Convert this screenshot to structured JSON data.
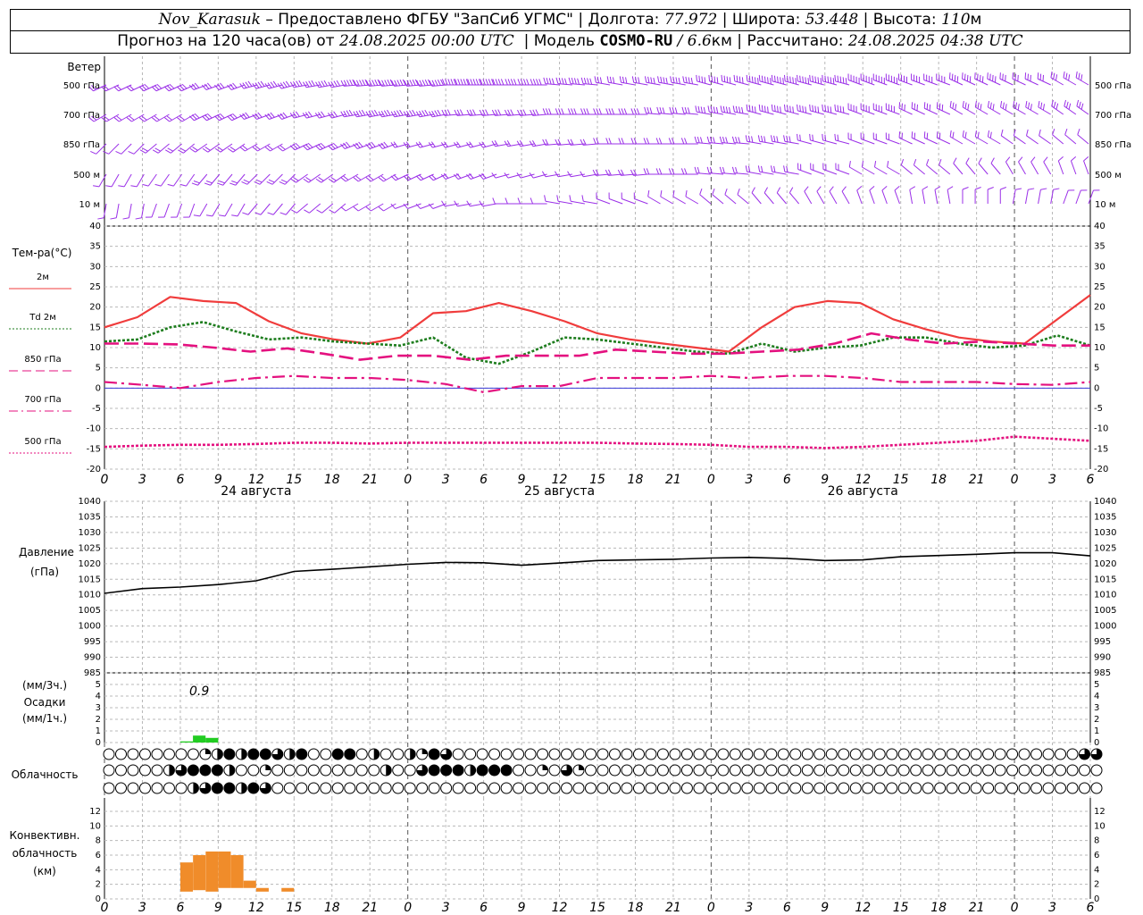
{
  "header": {
    "station": "Nov_Karasuk",
    "provider": "– Предоставлено ФГБУ \"ЗапСиб УГМС\"",
    "lon_label": "Долгота:",
    "lon_value": "77.972",
    "lat_label": "Широта:",
    "lat_value": "53.448",
    "alt_label": "Высота:",
    "alt_value": "110",
    "alt_unit": "м",
    "forecast_prefix": "Прогноз на 120 часа(ов) от",
    "forecast_start": "24.08.2025 00:00 UTC",
    "model_label": "Модель",
    "model_name": "COSMO-RU",
    "model_res": "/ 6.6",
    "model_res_unit": "км",
    "calc_label": "Рассчитано:",
    "calc_time": "24.08.2025 04:38 UTC"
  },
  "wind_panel": {
    "title": "Ветер",
    "levels": [
      "500 гПа",
      "700 гПа",
      "850 гПа",
      "500 м",
      "10  м"
    ],
    "color": "#9b30e8"
  },
  "temp_panel": {
    "title": "Тем-ра(°C)",
    "legend": [
      {
        "label": "2м",
        "color": "#f03c3c",
        "style": "solid"
      },
      {
        "label": "Td  2м",
        "color": "#1e7d1e",
        "style": "dotted"
      },
      {
        "label": "850 гПа",
        "color": "#e4117f",
        "style": "dash"
      },
      {
        "label": "700 гПа",
        "color": "#e4117f",
        "style": "dashdot"
      },
      {
        "label": "500 гПа",
        "color": "#e4117f",
        "style": "dotted"
      }
    ],
    "y_ticks": [
      "40",
      "35",
      "30",
      "25",
      "20",
      "15",
      "10",
      "5",
      "0",
      "-5",
      "-10",
      "-15",
      "-20"
    ]
  },
  "x_axis": {
    "ticks": [
      "0",
      "3",
      "6",
      "9",
      "12",
      "15",
      "18",
      "21",
      "0",
      "3",
      "6",
      "9",
      "12",
      "15",
      "18",
      "21",
      "0",
      "3",
      "6",
      "9",
      "12",
      "15",
      "18",
      "21",
      "0",
      "3",
      "6"
    ],
    "dates": [
      "24 августа",
      "25 августа",
      "26 августа"
    ]
  },
  "pressure_panel": {
    "title": "Давление",
    "unit": "(гПа)",
    "y_ticks": [
      "1040",
      "1035",
      "1030",
      "1025",
      "1020",
      "1015",
      "1010",
      "1005",
      "1000",
      "995",
      "990",
      "985"
    ]
  },
  "precip_panel": {
    "unit_top": "(мм/3ч.)",
    "title": "Осадки",
    "unit_bottom": "(мм/1ч.)",
    "annotation": "0.9",
    "y_ticks": [
      "5",
      "4",
      "3",
      "2",
      "1",
      "0"
    ],
    "color": "#22cc22"
  },
  "cloud_panel": {
    "title": "Облачность",
    "rows": [
      [
        0,
        0,
        0,
        0,
        0,
        0,
        0,
        0,
        1,
        2,
        4,
        2,
        4,
        4,
        3,
        2,
        4,
        0,
        0,
        4,
        4,
        0,
        2,
        0,
        0,
        2,
        1,
        4,
        3,
        0,
        0,
        0,
        0,
        0,
        0,
        0,
        0,
        0,
        0,
        0,
        0,
        0,
        0,
        0,
        0,
        0,
        0,
        0,
        0,
        0,
        0,
        0,
        0,
        0,
        0,
        0,
        0,
        0,
        0,
        0,
        0,
        0,
        0,
        0,
        0,
        0,
        0,
        0,
        0,
        0,
        0,
        0,
        0,
        0,
        0,
        0,
        0,
        0,
        0,
        0,
        0,
        3,
        3
      ],
      [
        0,
        0,
        0,
        0,
        0,
        2,
        3,
        4,
        4,
        4,
        2,
        0,
        0,
        1,
        0,
        0,
        0,
        0,
        0,
        0,
        0,
        0,
        0,
        2,
        0,
        0,
        3,
        4,
        4,
        4,
        2,
        4,
        4,
        4,
        0,
        0,
        1,
        0,
        3,
        1,
        0,
        0,
        0,
        0,
        0,
        0,
        0,
        0,
        0,
        0,
        0,
        0,
        0,
        0,
        0,
        0,
        0,
        0,
        0,
        0,
        0,
        0,
        0,
        0,
        0,
        0,
        0,
        0,
        0,
        0,
        0,
        0,
        0,
        0,
        0,
        0,
        0,
        0,
        0,
        0,
        0,
        0,
        0
      ],
      [
        0,
        0,
        0,
        0,
        0,
        0,
        0,
        2,
        3,
        4,
        4,
        2,
        4,
        3,
        0,
        0,
        0,
        0,
        0,
        0,
        0,
        0,
        0,
        0,
        0,
        0,
        0,
        0,
        0,
        0,
        0,
        0,
        0,
        0,
        0,
        0,
        0,
        0,
        0,
        0,
        0,
        0,
        0,
        0,
        0,
        0,
        0,
        0,
        0,
        0,
        0,
        0,
        0,
        0,
        0,
        0,
        0,
        0,
        0,
        0,
        0,
        0,
        0,
        0,
        0,
        0,
        0,
        0,
        0,
        0,
        0,
        0,
        0,
        0,
        0,
        0,
        0,
        0,
        0,
        0,
        0,
        0,
        0
      ]
    ]
  },
  "conv_panel": {
    "title_1": "Конвективн.",
    "title_2": "облачность",
    "unit": "(км)",
    "y_ticks": [
      "12",
      "10",
      "8",
      "6",
      "4",
      "2",
      "0"
    ],
    "color": "#f08c2a"
  },
  "chart_data": [
    {
      "type": "line",
      "title": "Тем-ра(°C)",
      "x_hours": [
        0,
        3,
        6,
        9,
        12,
        15,
        18,
        21,
        24,
        27,
        30,
        33,
        36,
        39,
        42,
        45,
        48,
        51,
        54,
        57,
        60,
        63,
        66,
        69,
        72,
        75,
        78
      ],
      "ylim": [
        -20,
        40
      ],
      "series": [
        {
          "name": "2м",
          "values": [
            15,
            17.5,
            22.5,
            21.5,
            21,
            16.5,
            13.5,
            12,
            11,
            12.5,
            18.5,
            19,
            21,
            19,
            16.5,
            13.5,
            12,
            11,
            10,
            9,
            15,
            20,
            21.5,
            21,
            17,
            14.5,
            12.5,
            11.5,
            11,
            17,
            23
          ]
        },
        {
          "name": "Td  2м",
          "values": [
            11.5,
            12,
            15,
            16.3,
            14,
            12,
            12.5,
            11.5,
            11,
            10.5,
            12.5,
            7.5,
            6,
            9,
            12.5,
            12,
            11,
            10,
            9,
            8.5,
            11,
            9,
            10,
            10.5,
            12.5,
            12.5,
            11,
            10,
            10.5,
            13,
            10.5
          ]
        },
        {
          "name": "850 гПа",
          "values": [
            11,
            11,
            10.8,
            10,
            9,
            9.8,
            8.5,
            7,
            8,
            8,
            7,
            8,
            8,
            8,
            9.5,
            9,
            8.5,
            8.5,
            9,
            9.5,
            11,
            13.5,
            12,
            11,
            11.5,
            11,
            10.5,
            10.5
          ]
        },
        {
          "name": "700 гПа",
          "values": [
            1.5,
            0.8,
            0,
            1.5,
            2.5,
            3,
            2.5,
            2.5,
            2,
            1,
            -1,
            0.5,
            0.5,
            2.5,
            2.5,
            2.5,
            3,
            2.5,
            3,
            3,
            2.5,
            1.5,
            1.5,
            1.5,
            1,
            0.8,
            1.5
          ]
        },
        {
          "name": "500 гПа",
          "values": [
            -14.5,
            -14.2,
            -14,
            -14,
            -13.8,
            -13.5,
            -13.5,
            -13.7,
            -13.5,
            -13.5,
            -13.5,
            -13.5,
            -13.5,
            -13.5,
            -13.7,
            -13.8,
            -14,
            -14.5,
            -14.5,
            -14.8,
            -14.5,
            -14,
            -13.5,
            -13,
            -12,
            -12.5,
            -13
          ]
        }
      ]
    },
    {
      "type": "line",
      "title": "Давление",
      "ylabel": "(гПа)",
      "ylim": [
        985,
        1040
      ],
      "x_hours": [
        0,
        3,
        6,
        9,
        12,
        15,
        18,
        21,
        24,
        27,
        30,
        33,
        36,
        39,
        42,
        45,
        48,
        51,
        54,
        57,
        60,
        63,
        66,
        69,
        72,
        75,
        78
      ],
      "series": [
        {
          "name": "Давление",
          "values": [
            1010.5,
            1012,
            1012.5,
            1013.3,
            1014.5,
            1017.5,
            1018.2,
            1019,
            1019.8,
            1020.4,
            1020.3,
            1019.5,
            1020.2,
            1021,
            1021.2,
            1021.4,
            1021.8,
            1022,
            1021.7,
            1021,
            1021.2,
            1022.2,
            1022.6,
            1023,
            1023.5,
            1023.5,
            1022.5
          ]
        }
      ]
    },
    {
      "type": "bar",
      "title": "Осадки",
      "ylim": [
        0,
        5
      ],
      "x_hours": [
        6,
        7,
        8
      ],
      "values": [
        0.1,
        0.6,
        0.4
      ],
      "annotation": "0.9"
    },
    {
      "type": "bar",
      "title": "Конвективн. облачность",
      "ylabel": "(км)",
      "ylim": [
        0,
        13
      ],
      "x_hours": [
        6.5,
        7.5,
        8.5,
        9.5,
        10.5,
        11.5,
        12.5,
        14.5
      ],
      "base_km": [
        1,
        1.2,
        1,
        1.5,
        1.5,
        1.5,
        1,
        1
      ],
      "top_km": [
        5,
        6,
        6.5,
        6.5,
        6,
        2.5,
        1.5,
        1.5
      ]
    }
  ]
}
